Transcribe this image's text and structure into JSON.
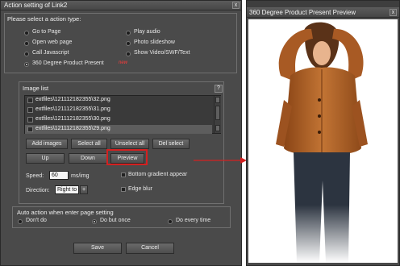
{
  "dialog": {
    "title": "Action setting of Link2",
    "close_glyph": "x",
    "action_group": {
      "label": "Please select a action type:",
      "options": [
        {
          "label": "Go to Page",
          "selected": false
        },
        {
          "label": "Open web page",
          "selected": false
        },
        {
          "label": "Call Javascript",
          "selected": false
        },
        {
          "label": "360 Degree Product Present",
          "selected": true,
          "marker": "new"
        },
        {
          "label": "Play audio",
          "selected": false
        },
        {
          "label": "Photo slideshow",
          "selected": false
        },
        {
          "label": "Show Video/SWF/Text",
          "selected": false
        }
      ]
    },
    "image_list": {
      "label": "Image list",
      "help_glyph": "?",
      "files": [
        {
          "name": "extfiles\\121112182355\\32.png",
          "selected": false
        },
        {
          "name": "extfiles\\121112182355\\31.png",
          "selected": false
        },
        {
          "name": "extfiles\\121112182355\\30.png",
          "selected": false
        },
        {
          "name": "extfiles\\121112182355\\29.png",
          "selected": true
        }
      ],
      "buttons": {
        "add_images": "Add images",
        "select_all": "Select all",
        "unselect_all": "Unselect all",
        "del_select": "Del select",
        "up": "Up",
        "down": "Down",
        "preview": "Preview"
      },
      "speed_label": "Speed:",
      "speed_value": "60",
      "speed_unit": "ms/img",
      "direction_label": "Direction:",
      "direction_value": "Right to",
      "direction_arrow": "+",
      "bottom_gradient_label": "Bottom gradient appear",
      "edge_blur_label": "Edge blur"
    },
    "auto_action": {
      "label": "Auto action when enter page setting",
      "options": [
        {
          "label": "Don't do",
          "selected": false
        },
        {
          "label": "Do but once",
          "selected": true
        },
        {
          "label": "Do every time",
          "selected": false
        }
      ]
    },
    "save_label": "Save",
    "cancel_label": "Cancel"
  },
  "preview_window": {
    "title": "360 Degree Product Present Preview",
    "close_glyph": "x"
  },
  "colors": {
    "dialog_bg": "#4a4a4a",
    "highlight_red": "#d42020",
    "jacket": "#b0622a"
  }
}
